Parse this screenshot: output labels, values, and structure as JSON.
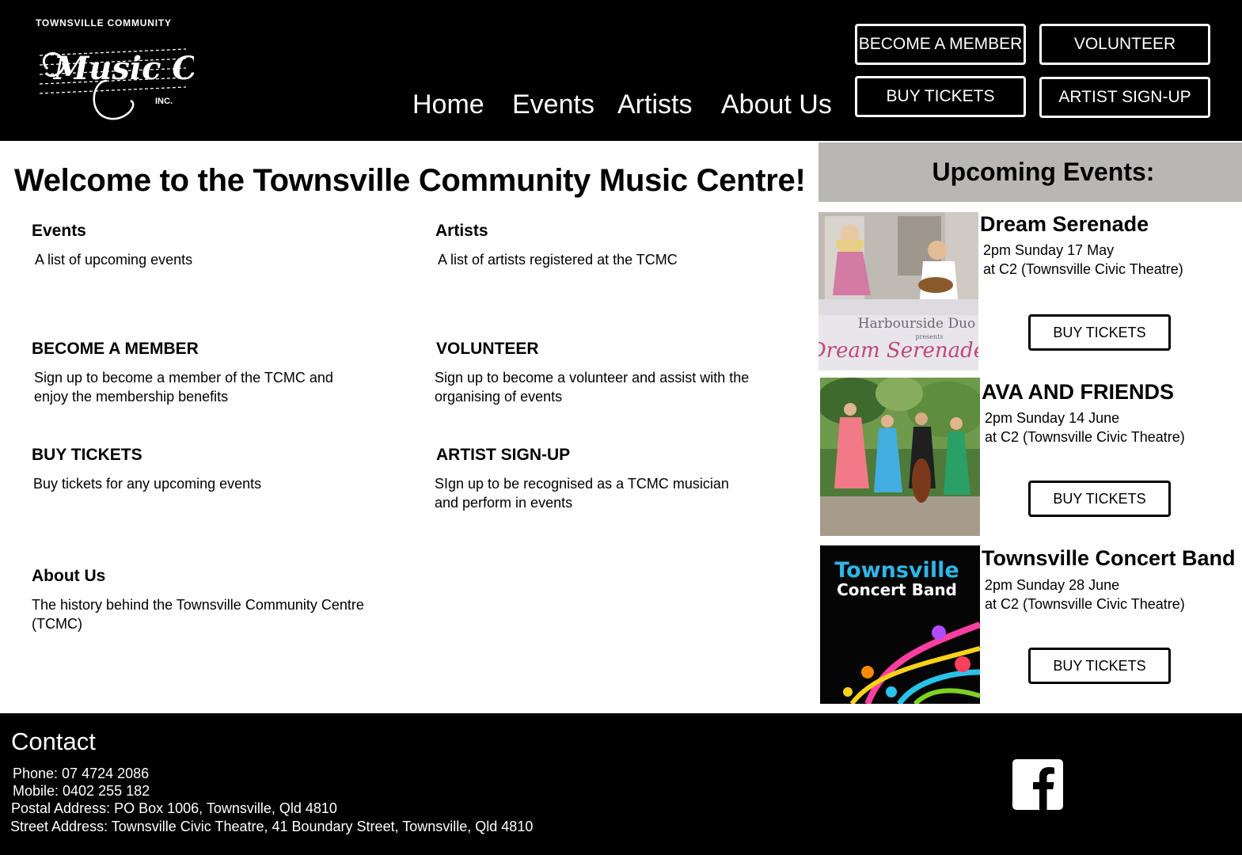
{
  "header": {
    "logo": {
      "top_text": "TOWNSVILLE COMMUNITY",
      "script_text": "Music Centre",
      "inc_text": "INC."
    },
    "nav": [
      "Home",
      "Events",
      "Artists",
      "About Us"
    ],
    "buttons": {
      "become_member": "BECOME A MEMBER",
      "volunteer": "VOLUNTEER",
      "buy_tickets": "BUY TICKETS",
      "artist_signup": "ARTIST SIGN-UP"
    }
  },
  "main": {
    "welcome": "Welcome to the Townsville Community Music Centre!",
    "sections": [
      {
        "title": "Events",
        "description": "A list of upcoming events"
      },
      {
        "title": "Artists",
        "description": "A list of artists registered at the TCMC"
      },
      {
        "title": "BECOME A MEMBER",
        "description": "Sign up to become a member of the TCMC and enjoy the membership benefits"
      },
      {
        "title": "VOLUNTEER",
        "description": "Sign up to become a volunteer and assist with the organising of events"
      },
      {
        "title": "BUY TICKETS",
        "description": "Buy tickets for any upcoming events"
      },
      {
        "title": "ARTIST SIGN-UP",
        "description": "SIgn up to be recognised as a TCMC musician and perform in events"
      },
      {
        "title": "About Us",
        "description": "The history behind the Townsville Community Centre (TCMC)"
      }
    ]
  },
  "sidebar": {
    "heading": "Upcoming Events:",
    "events": [
      {
        "title": "Dream Serenade",
        "time": "2pm Sunday 17 May",
        "venue": "at C2 (Townsville Civic Theatre)",
        "button": "BUY TICKETS",
        "poster_text": {
          "line1": "Harbourside Duo",
          "line2": "presents",
          "line3": "Dream Serenade"
        }
      },
      {
        "title": "AVA AND FRIENDS",
        "time": "2pm Sunday 14 June",
        "venue": "at C2 (Townsville Civic Theatre)",
        "button": "BUY TICKETS"
      },
      {
        "title": "Townsville Concert Band",
        "time": "2pm Sunday 28 June",
        "venue": "at C2 (Townsville Civic Theatre)",
        "button": "BUY TICKETS",
        "poster_text": {
          "line1": "Townsville",
          "line2": "Concert Band"
        }
      }
    ]
  },
  "footer": {
    "contact_title": "Contact",
    "phone": "Phone: 07 4724 2086",
    "mobile": "Mobile: 0402 255 182",
    "postal": "Postal Address:  PO Box 1006, Townsville, Qld 4810",
    "street": "Street Address:  Townsville Civic Theatre, 41 Boundary Street, Townsville, Qld 4810",
    "social_icon": "facebook-icon"
  },
  "colors": {
    "header_bg": "#000000",
    "footer_bg": "#000000",
    "sidebar_heading_bg": "#b9b6b6",
    "text": "#000000",
    "header_text": "#ffffff"
  }
}
